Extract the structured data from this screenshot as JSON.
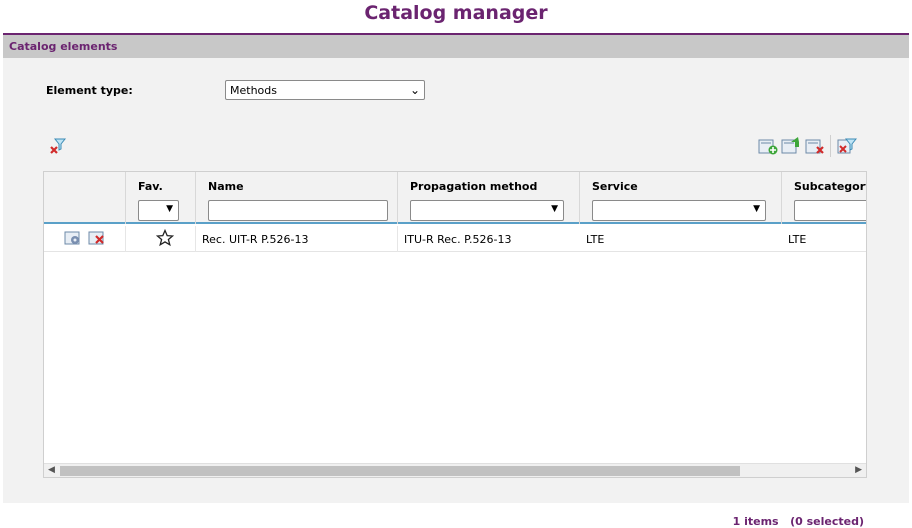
{
  "page_title": "Catalog manager",
  "panel": {
    "title": "Catalog elements"
  },
  "element_type": {
    "label": "Element type:",
    "value": "Methods"
  },
  "toolbar_icons": [
    "clear-filter-icon",
    "add-icon",
    "import-icon",
    "delete-selected-icon",
    "clear-favorites-icon"
  ],
  "grid": {
    "columns": [
      "Fav.",
      "Name",
      "Propagation method",
      "Service",
      "Subcategory"
    ],
    "rows": [
      {
        "name": "Rec. UIT-R P.526-13",
        "propagation_method": "ITU-R Rec. P.526-13",
        "service": "LTE",
        "subcategory": "LTE"
      }
    ]
  },
  "status": {
    "items": "1 items",
    "selected": "(0 selected)"
  },
  "colors": {
    "accent": "#6b2470",
    "header_bar": "#c8c8c8",
    "grid_line": "#5aa0c8"
  }
}
